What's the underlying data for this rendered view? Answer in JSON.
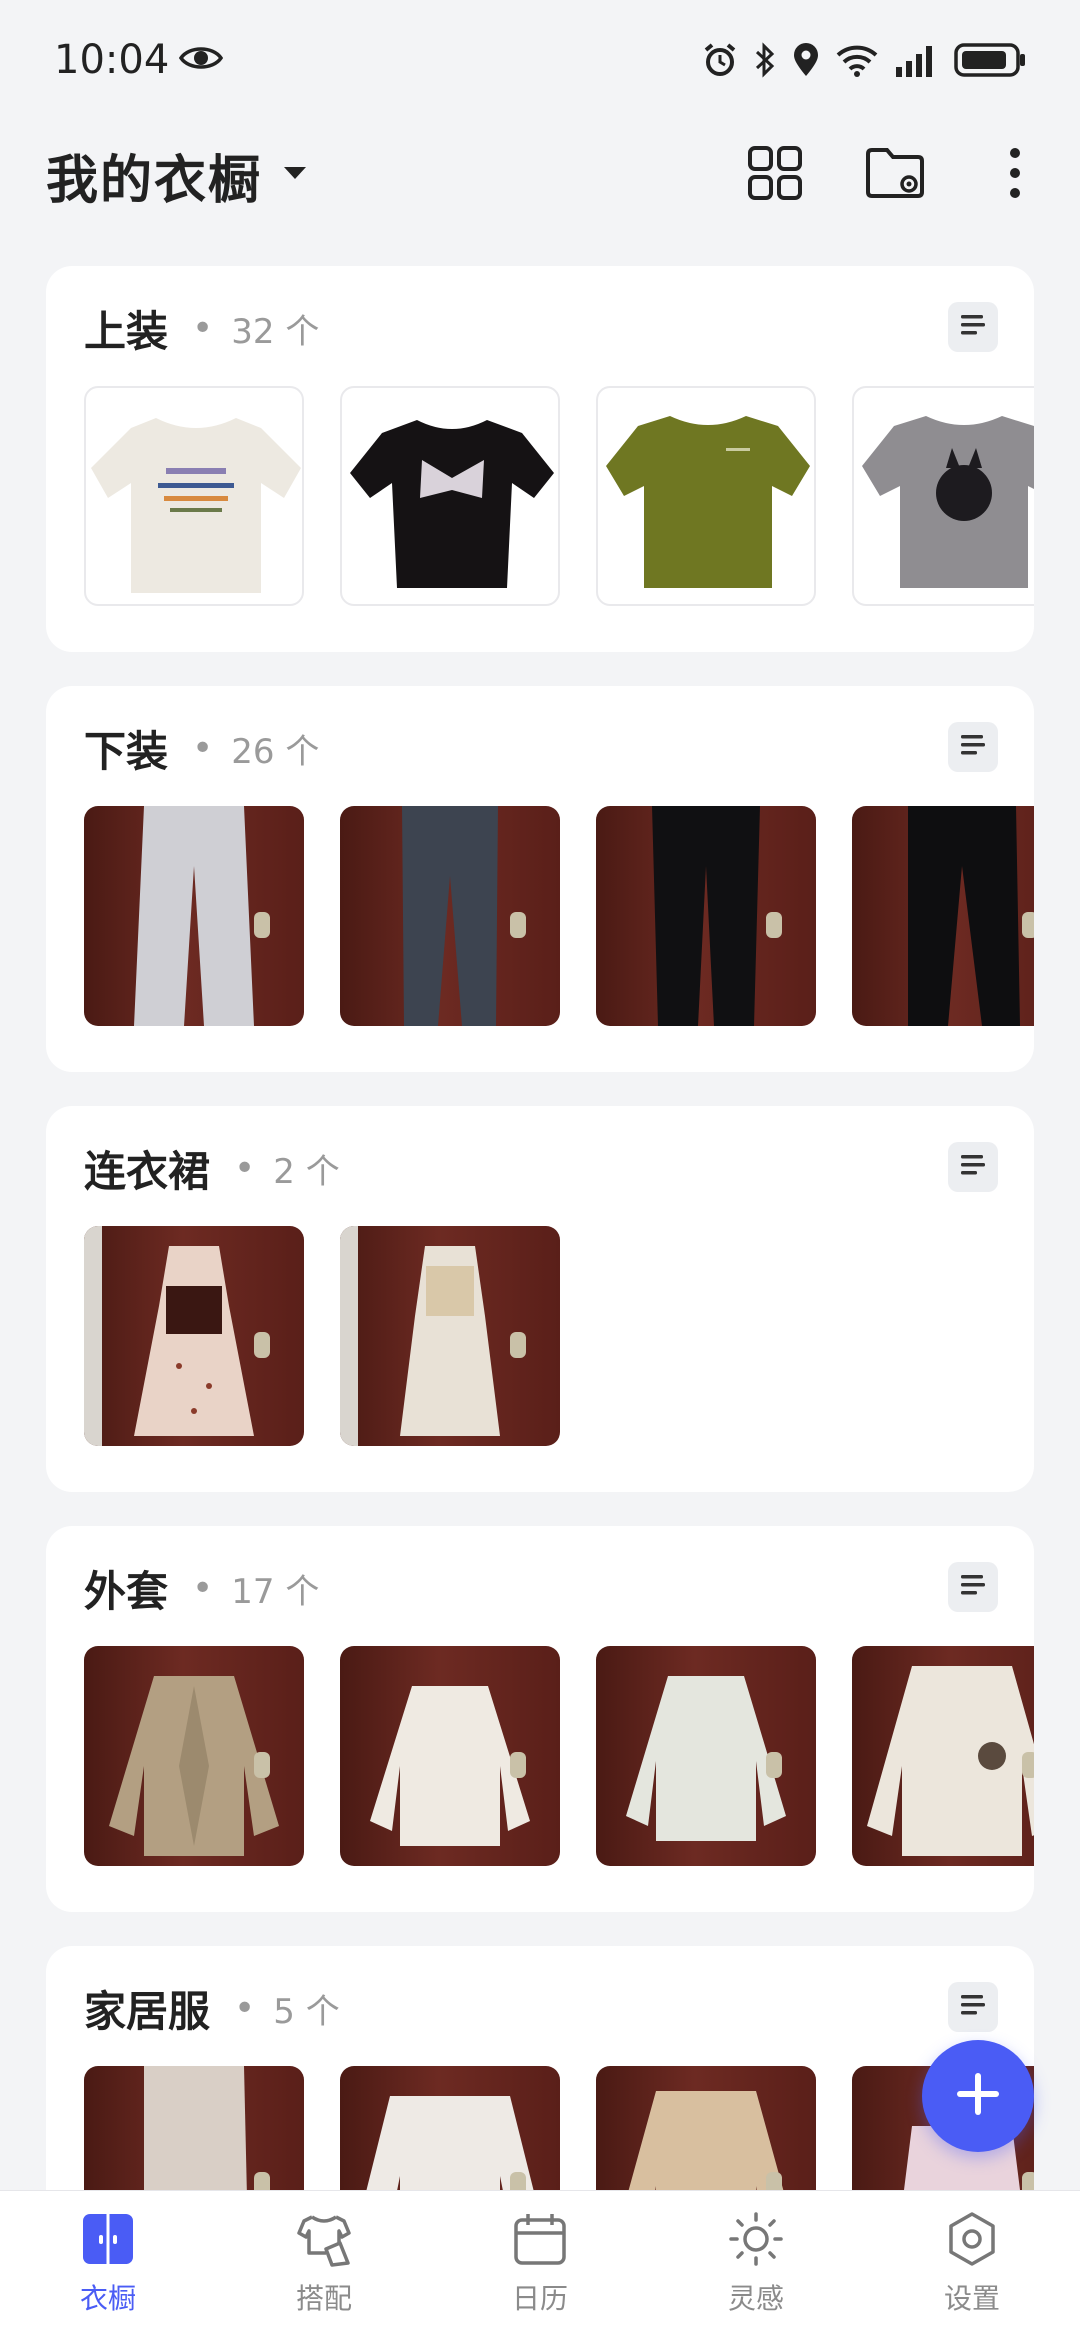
{
  "status_bar": {
    "time": "10:04",
    "icons": [
      "eye-icon",
      "alarm-icon",
      "bluetooth-icon",
      "location-icon",
      "wifi-icon",
      "signal-icon",
      "battery-icon"
    ]
  },
  "header": {
    "title": "我的衣橱",
    "actions": [
      "grid-view-icon",
      "folder-settings-icon",
      "more-icon"
    ]
  },
  "categories": [
    {
      "name": "上装",
      "count": "32 个"
    },
    {
      "name": "下装",
      "count": "26 个"
    },
    {
      "name": "连衣裙",
      "count": "2 个"
    },
    {
      "name": "外套",
      "count": "17 个"
    },
    {
      "name": "家居服",
      "count": "5 个"
    }
  ],
  "nav": {
    "items": [
      {
        "label": "衣橱",
        "icon": "wardrobe-icon"
      },
      {
        "label": "搭配",
        "icon": "outfit-icon"
      },
      {
        "label": "日历",
        "icon": "calendar-icon"
      },
      {
        "label": "灵感",
        "icon": "inspiration-icon"
      },
      {
        "label": "设置",
        "icon": "settings-icon"
      }
    ],
    "active": "衣橱"
  },
  "colors": {
    "accent": "#4a5cf5",
    "background": "#f3f4f6",
    "card": "#ffffff"
  }
}
